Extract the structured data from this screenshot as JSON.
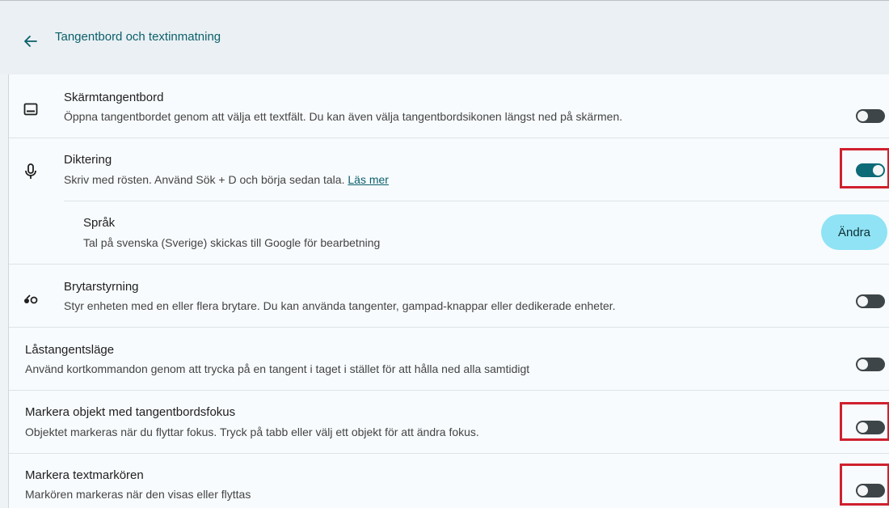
{
  "header": {
    "back_icon": "arrow-left-icon",
    "title": "Tangentbord och textinmatning"
  },
  "settings": [
    {
      "icon": "keyboard-icon",
      "title": "Skärmtangentbord",
      "subtitle": "Öppna tangentbordet genom att välja ett textfält. Du kan även välja tangentbordsikonen längst ned på skärmen.",
      "toggle": false
    },
    {
      "icon": "microphone-icon",
      "title": "Diktering",
      "subtitle": "Skriv med rösten. Använd Sök + D och börja sedan tala.",
      "link": "Läs mer",
      "toggle": true,
      "highlighted": true
    },
    {
      "title": "Språk",
      "subtitle": "Tal på svenska (Sverige) skickas till Google för bearbetning",
      "button": "Ändra"
    },
    {
      "icon": "switch-access-icon",
      "title": "Brytarstyrning",
      "subtitle": "Styr enheten med en eller flera brytare. Du kan använda tangenter, gampad-knappar eller dedikerade enheter.",
      "toggle": false
    },
    {
      "title": "Låstangentsläge",
      "subtitle": "Använd kortkommandon genom att trycka på en tangent i taget i stället för att hålla ned alla samtidigt",
      "toggle": false
    },
    {
      "title": "Markera objekt med tangentbordsfokus",
      "subtitle": "Objektet markeras när du flyttar fokus. Tryck på tabb eller välj ett objekt för att ändra fokus.",
      "toggle": false,
      "highlighted": true
    },
    {
      "title": "Markera textmarkören",
      "subtitle": "Markören markeras när den visas eller flyttas",
      "toggle": false,
      "highlighted": true
    }
  ],
  "colors": {
    "accent": "#0d6a77",
    "highlight": "#d0202e",
    "button_bg": "#8fe3f4"
  }
}
